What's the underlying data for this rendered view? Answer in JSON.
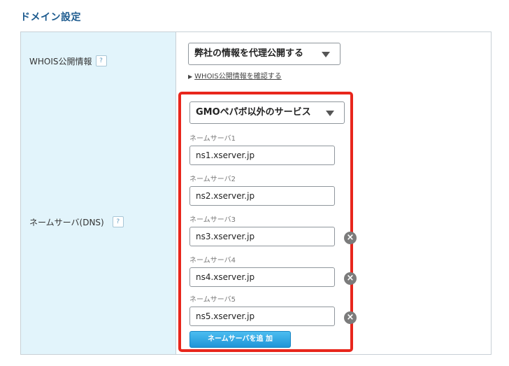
{
  "section": {
    "title": "ドメイン設定"
  },
  "whois": {
    "label": "WHOIS公開情報",
    "help": "?",
    "select_value": "弊社の情報を代理公開する",
    "link_text": "WHOIS公開情報を確認する",
    "link_marker": "▶"
  },
  "nameserver": {
    "label": "ネームサーバ(DNS)",
    "help": "?",
    "select_value": "GMOペパボ以外のサービス",
    "fields": [
      {
        "label": "ネームサーバ1",
        "value": "ns1.xserver.jp"
      },
      {
        "label": "ネームサーバ2",
        "value": "ns2.xserver.jp"
      },
      {
        "label": "ネームサーバ3",
        "value": "ns3.xserver.jp",
        "removable": true
      },
      {
        "label": "ネームサーバ4",
        "value": "ns4.xserver.jp",
        "removable": true
      },
      {
        "label": "ネームサーバ5",
        "value": "ns5.xserver.jp",
        "removable": true
      }
    ],
    "remove_glyph": "×",
    "add_button": "ネームサーバを追 加"
  },
  "colors": {
    "label_bg": "#e2f4fb",
    "highlight": "#e8261c",
    "button": "#29a3e2",
    "title": "#1c5a8e"
  }
}
